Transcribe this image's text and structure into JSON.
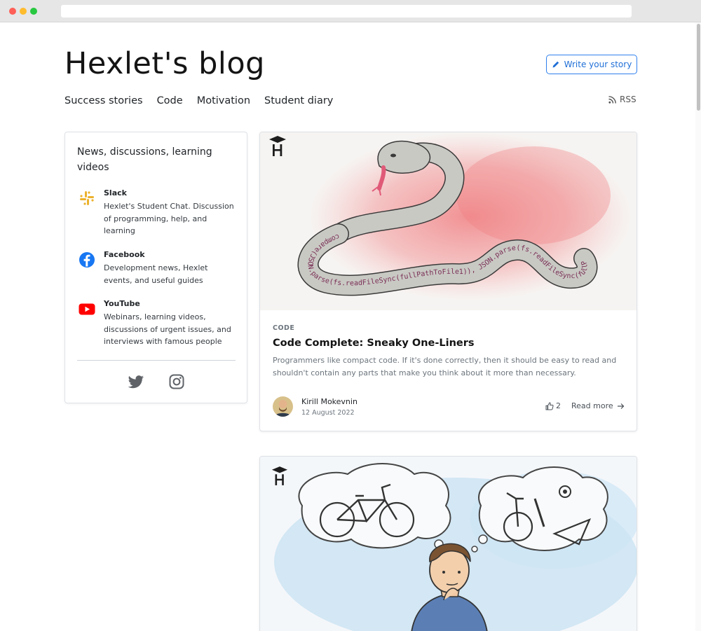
{
  "blog": {
    "title": "Hexlet's blog",
    "write_story_label": "Write your story",
    "rss_label": "RSS",
    "nav": [
      "Success stories",
      "Code",
      "Motivation",
      "Student diary"
    ]
  },
  "sidebar": {
    "title": "News, discussions, learning videos",
    "communities": [
      {
        "name": "Slack",
        "description": "Hexlet's Student Chat. Discussion of programming, help, and learning",
        "icon": "slack-icon"
      },
      {
        "name": "Facebook",
        "description": "Development news, Hexlet events, and useful guides",
        "icon": "facebook-icon"
      },
      {
        "name": "YouTube",
        "description": "Webinars, learning videos, discussions of urgent issues, and interviews with famous people",
        "icon": "youtube-icon"
      }
    ],
    "social_icons": [
      "twitter-icon",
      "instagram-icon"
    ]
  },
  "posts": [
    {
      "category": "CODE",
      "title": "Code Complete: Sneaky One-Liners",
      "excerpt": "Programmers like compact code. If it's done correctly, then it should be easy to read and shouldn't contain any parts that make you think about it more than necessary.",
      "author": "Kirill Mokevnin",
      "date": "12 August 2022",
      "likes": "2",
      "read_more_label": "Read more",
      "image_code": "compare(JSON.parse(fs.readFileSync(fullPathToFile1)), JSON.parse(fs.readFileSync(fullPathToFile2)));"
    }
  ],
  "colors": {
    "accent": "#2f80ed",
    "slack_yellow": "#ecb22e",
    "facebook_blue": "#1877f2",
    "youtube_red": "#ff0000"
  }
}
